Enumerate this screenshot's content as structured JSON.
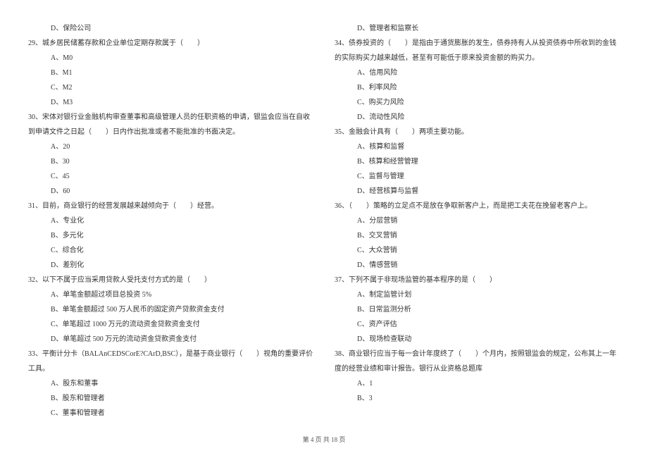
{
  "left": {
    "opt_before_29": "D、保险公司",
    "q29": "29、城乡居民储蓄存款和企业单位定期存款属于（　　）",
    "q29_a": "A、M0",
    "q29_b": "B、M1",
    "q29_c": "C、M2",
    "q29_d": "D、M3",
    "q30": "30、宋体对银行业金融机构审查董事和高级管理人员的任职资格的申请，银监会应当在自收到申请文件之日起（　　）日内作出批准或者不能批准的书面决定。",
    "q30_a": "A、20",
    "q30_b": "B、30",
    "q30_c": "C、45",
    "q30_d": "D、60",
    "q31": "31、目前，商业银行的经营发展越来越倾向于（　　）经营。",
    "q31_a": "A、专业化",
    "q31_b": "B、多元化",
    "q31_c": "C、综合化",
    "q31_d": "D、差别化",
    "q32": "32、以下不属于应当采用贷款人受托支付方式的是（　　）",
    "q32_a": "A、单笔金额超过项目总投资 5%",
    "q32_b": "B、单笔金额超过 500 万人民币的固定资产贷款资金支付",
    "q32_c": "C、单笔超过 1000 万元的流动资金贷款资金支付",
    "q32_d": "D、单笔超过 500 万元的流动资金贷款资金支付",
    "q33": "33、平衡计分卡（BALAnCEDSCorE?CArD,BSC），是基于商业银行（　　）视角的重要评价工具。",
    "q33_a": "A、股东和董事",
    "q33_b": "B、股东和管理者",
    "q33_c": "C、董事和管理者"
  },
  "right": {
    "q33_d": "D、管理者和监察长",
    "q34": "34、债券投资的（　　）是指由于通货膨胀的发生，债券持有人从投资债券中所收到的金钱的实际购买力越来越低，甚至有可能低于原来投资金额的购买力。",
    "q34_a": "A、信用风险",
    "q34_b": "B、利率风险",
    "q34_c": "C、购买力风险",
    "q34_d": "D、流动性风险",
    "q35": "35、金融会计具有（　　）两项主要功能。",
    "q35_a": "A、核算和监督",
    "q35_b": "B、核算和经营管理",
    "q35_c": "C、监督与管理",
    "q35_d": "D、经营核算与监督",
    "q36": "36、（　　）策略的立足点不是放在争取新客户上，而是把工夫花在挽留老客户上。",
    "q36_a": "A、分层营销",
    "q36_b": "B、交叉营销",
    "q36_c": "C、大众营销",
    "q36_d": "D、情感营销",
    "q37": "37、下列不属于非现场监管的基本程序的是（　　）",
    "q37_a": "A、制定监管计划",
    "q37_b": "B、日常监测分析",
    "q37_c": "C、资产评估",
    "q37_d": "D、现场检查联动",
    "q38": "38、商业银行应当于每一会计年度终了（　　）个月内，按照银监会的规定，公布其上一年度的经营业绩和审计报告。银行从业资格总题库",
    "q38_a": "A、1",
    "q38_b": "B、3"
  },
  "footer": "第 4 页 共 18 页"
}
